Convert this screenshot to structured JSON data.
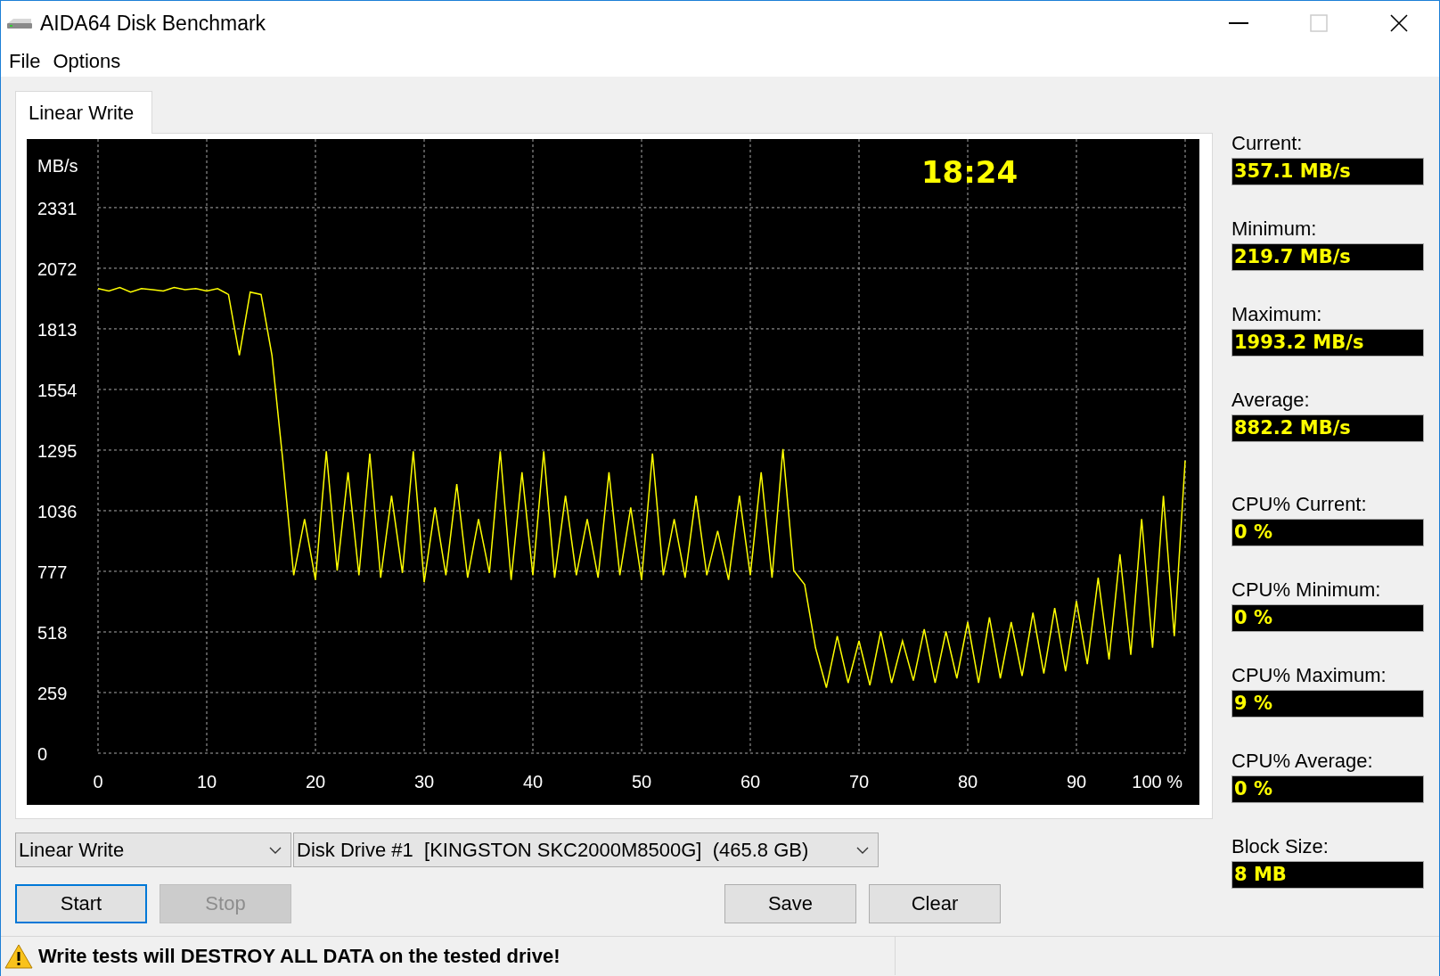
{
  "window": {
    "title": "AIDA64 Disk Benchmark",
    "maximize_disabled": true
  },
  "menu": [
    {
      "label": "File"
    },
    {
      "label": "Options"
    }
  ],
  "tabs": [
    {
      "label": "Linear Write",
      "selected": true
    }
  ],
  "chart": {
    "timer": "18:24",
    "chart_data": {
      "type": "line",
      "ylabel": "MB/s",
      "xlim": [
        0,
        100
      ],
      "ylim": [
        0,
        2624
      ],
      "grid": true,
      "xticks": [
        0,
        10,
        20,
        30,
        40,
        50,
        60,
        70,
        80,
        90,
        {
          "value": 100,
          "label": "100 %"
        }
      ],
      "yticks": [
        0,
        259,
        518,
        777,
        1036,
        1295,
        1554,
        1813,
        2072,
        2331
      ],
      "x": [
        0,
        1,
        2,
        3,
        4,
        5,
        6,
        7,
        8,
        9,
        10,
        11,
        12,
        13,
        14,
        15,
        16,
        17,
        18,
        19,
        20,
        21,
        22,
        23,
        24,
        25,
        26,
        27,
        28,
        29,
        30,
        31,
        32,
        33,
        34,
        35,
        36,
        37,
        38,
        39,
        40,
        41,
        42,
        43,
        44,
        45,
        46,
        47,
        48,
        49,
        50,
        51,
        52,
        53,
        54,
        55,
        56,
        57,
        58,
        59,
        60,
        61,
        62,
        63,
        64,
        65,
        66,
        67,
        68,
        69,
        70,
        71,
        72,
        73,
        74,
        75,
        76,
        77,
        78,
        79,
        80,
        81,
        82,
        83,
        84,
        85,
        86,
        87,
        88,
        89,
        90,
        91,
        92,
        93,
        94,
        95,
        96,
        97,
        98,
        99,
        100
      ],
      "series": [
        {
          "color": "#ffff00",
          "values": [
            1985,
            1975,
            1990,
            1970,
            1985,
            1980,
            1975,
            1990,
            1980,
            1985,
            1975,
            1985,
            1960,
            1700,
            1970,
            1960,
            1700,
            1250,
            760,
            1000,
            740,
            1290,
            780,
            1200,
            760,
            1280,
            750,
            1100,
            770,
            1290,
            730,
            1050,
            760,
            1150,
            750,
            1000,
            770,
            1290,
            740,
            1200,
            760,
            1290,
            750,
            1100,
            760,
            1000,
            750,
            1200,
            760,
            1050,
            740,
            1280,
            760,
            1000,
            750,
            1100,
            760,
            950,
            740,
            1100,
            760,
            1200,
            750,
            1300,
            780,
            720,
            450,
            280,
            500,
            300,
            480,
            290,
            520,
            300,
            480,
            310,
            530,
            300,
            520,
            320,
            560,
            300,
            580,
            320,
            560,
            330,
            600,
            340,
            620,
            350,
            650,
            380,
            750,
            400,
            850,
            420,
            1000,
            450,
            1100,
            500,
            1250
          ]
        }
      ]
    }
  },
  "stat_groups": [
    [
      {
        "label": "Current:",
        "value": "357.1 MB/s"
      },
      {
        "label": "Minimum:",
        "value": "219.7 MB/s"
      },
      {
        "label": "Maximum:",
        "value": "1993.2 MB/s"
      },
      {
        "label": "Average:",
        "value": "882.2 MB/s"
      }
    ],
    [
      {
        "label": "CPU% Current:",
        "value": "0 %"
      },
      {
        "label": "CPU% Minimum:",
        "value": "0 %"
      },
      {
        "label": "CPU% Maximum:",
        "value": "9 %"
      },
      {
        "label": "CPU% Average:",
        "value": "0 %"
      },
      {
        "label": "Block Size:",
        "value": "8 MB"
      }
    ]
  ],
  "test_select": {
    "value": "Linear Write"
  },
  "drive_select": {
    "value": "Disk Drive #1  [KINGSTON SKC2000M8500G]  (465.8 GB)"
  },
  "run_buttons": [
    {
      "label": "Start",
      "disabled": false,
      "focused": true
    },
    {
      "label": "Stop",
      "disabled": true,
      "focused": false
    }
  ],
  "result_buttons": [
    {
      "label": "Save",
      "disabled": false,
      "focused": false
    },
    {
      "label": "Clear",
      "disabled": false,
      "focused": false
    }
  ],
  "status_bar": {
    "warning": "Write tests will DESTROY ALL DATA on the tested drive!"
  }
}
